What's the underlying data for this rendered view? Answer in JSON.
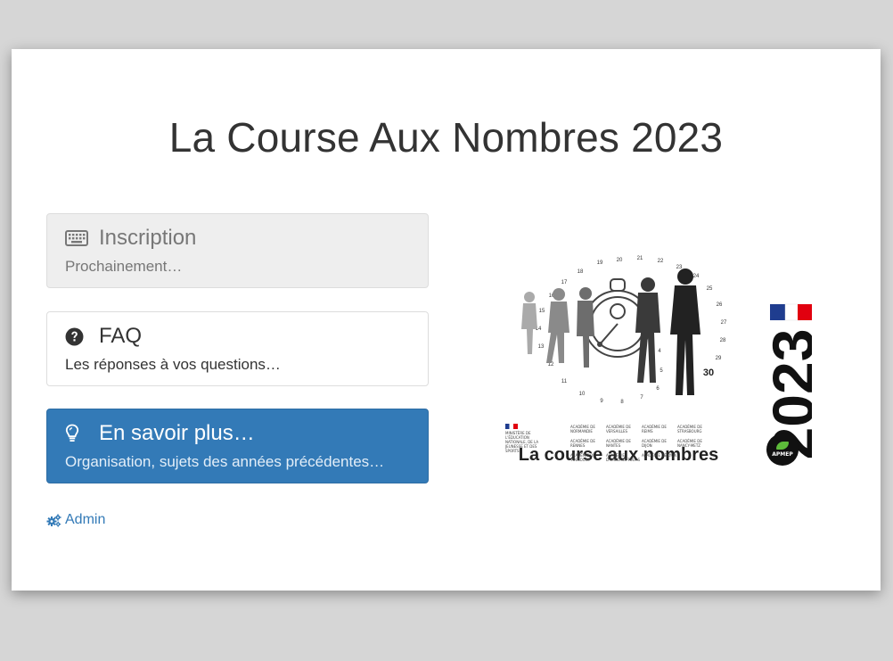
{
  "page": {
    "title": "La Course Aux Nombres 2023"
  },
  "panels": [
    {
      "id": "inscription",
      "icon": "keyboard-icon",
      "label": "Inscription",
      "sub": "Prochainement…"
    },
    {
      "id": "faq",
      "icon": "question-circle-icon",
      "label": "FAQ",
      "sub": "Les réponses à vos questions…"
    },
    {
      "id": "savoir",
      "icon": "lightbulb-icon",
      "label": "En savoir plus…",
      "sub": "Organisation, sujets des années précédentes…"
    }
  ],
  "admin": {
    "icon": "cogs-icon",
    "label": "Admin"
  },
  "logo": {
    "caption": "La course aux nombres",
    "year": "2023",
    "badge": "APMEP",
    "dial_label": "30",
    "ministry": "MINISTÈRE DE L'ÉDUCATION NATIONALE, DE LA JEUNESSE ET DES SPORTS",
    "academies": [
      "ACADÉMIE DE NORMANDIE",
      "ACADÉMIE DE VERSAILLES",
      "ACADÉMIE DE REIMS",
      "ACADÉMIE DE STRASBOURG",
      "ACADÉMIE DE RENNES",
      "ACADÉMIE DE NANTES",
      "ACADÉMIE DE DIJON",
      "ACADÉMIE DE NANCY-METZ",
      "ACADÉMIE DE TOULOUSE",
      "ACADÉMIE D'ORLÉANS-TOURS",
      "ACADÉMIE DE LYON"
    ]
  },
  "colors": {
    "primary": "#337ab7",
    "disabled_bg": "#eeeeee",
    "text": "#333333",
    "page_bg": "#d6d6d6"
  }
}
